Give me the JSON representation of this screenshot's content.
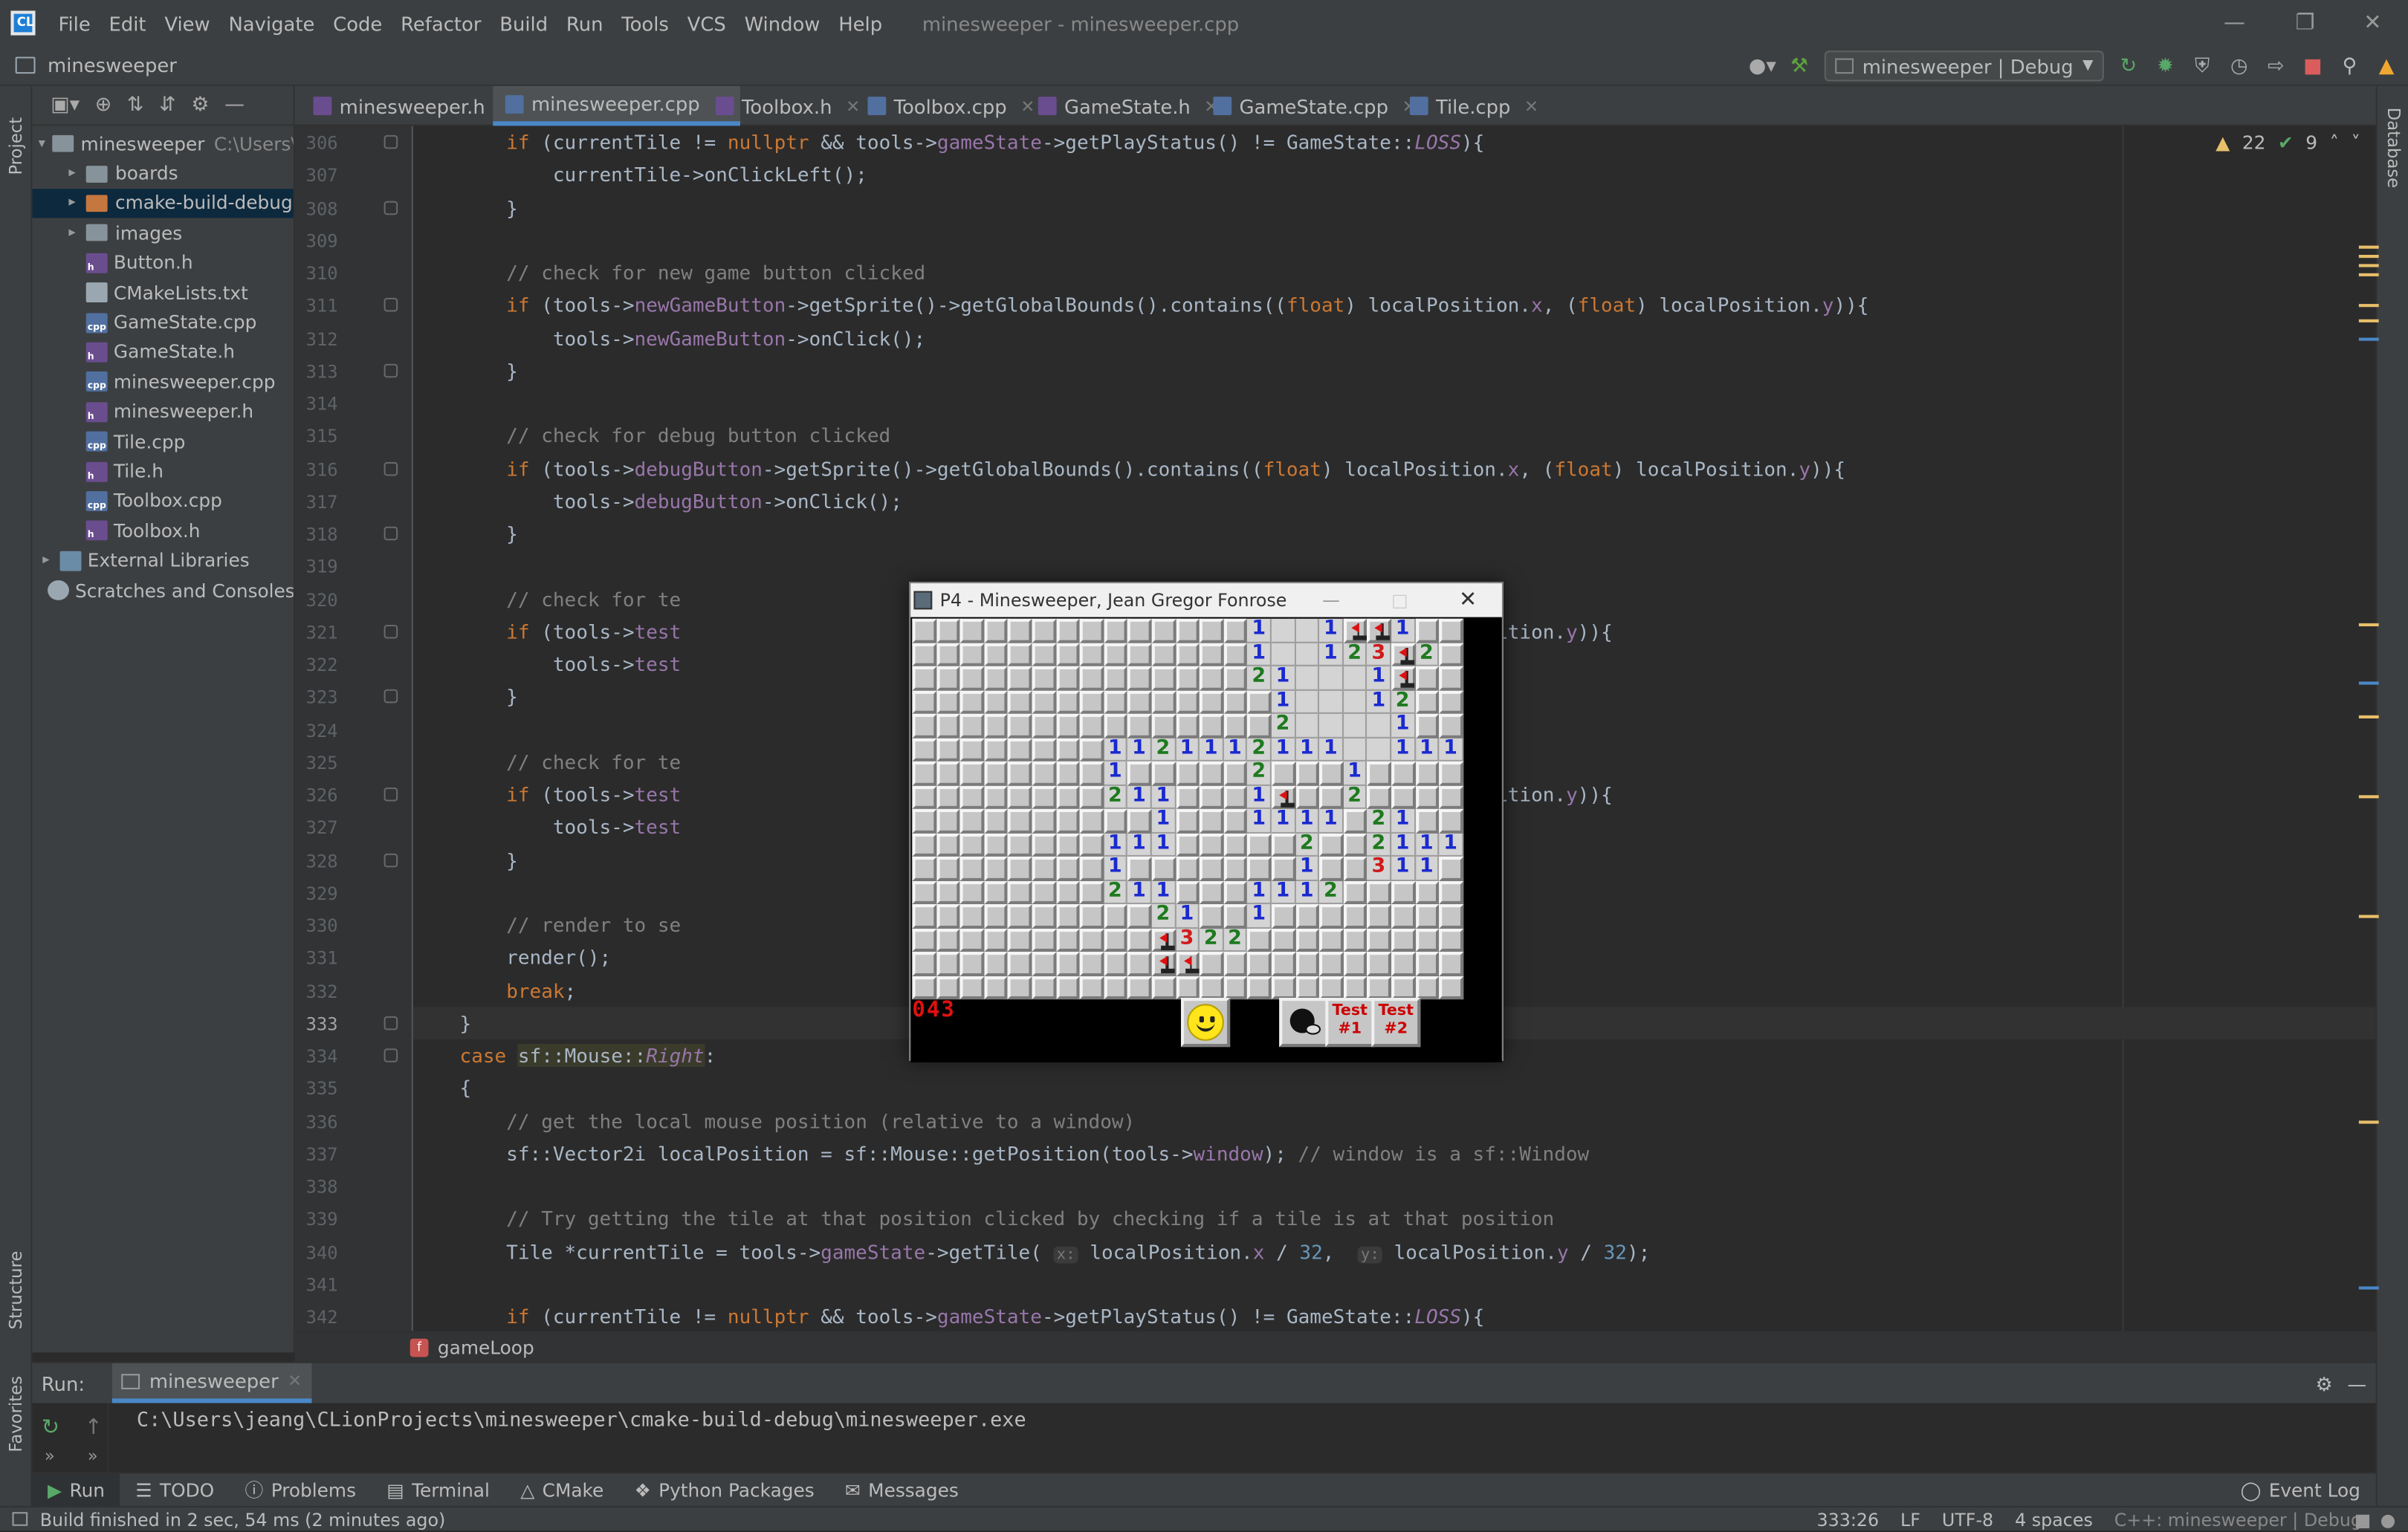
{
  "app": {
    "window_title": "minesweeper - minesweeper.cpp",
    "menu": [
      "File",
      "Edit",
      "View",
      "Navigate",
      "Code",
      "Refactor",
      "Build",
      "Run",
      "Tools",
      "VCS",
      "Window",
      "Help"
    ],
    "project_name": "minesweeper",
    "run_config": "minesweeper | Debug"
  },
  "sidebar": {
    "vertical_labels": {
      "project": "Project",
      "structure": "Structure",
      "favorites": "Favorites",
      "database": "Database"
    },
    "tree": [
      {
        "label": "minesweeper",
        "extra": "C:\\Users\\je",
        "type": "folder-open"
      },
      {
        "label": "boards",
        "type": "folder"
      },
      {
        "label": "cmake-build-debug",
        "type": "folder-orange"
      },
      {
        "label": "images",
        "type": "folder"
      },
      {
        "label": "Button.h",
        "type": "h"
      },
      {
        "label": "CMakeLists.txt",
        "type": "txt"
      },
      {
        "label": "GameState.cpp",
        "type": "cpp"
      },
      {
        "label": "GameState.h",
        "type": "h"
      },
      {
        "label": "minesweeper.cpp",
        "type": "cpp"
      },
      {
        "label": "minesweeper.h",
        "type": "h"
      },
      {
        "label": "Tile.cpp",
        "type": "cpp"
      },
      {
        "label": "Tile.h",
        "type": "h"
      },
      {
        "label": "Toolbox.cpp",
        "type": "cpp"
      },
      {
        "label": "Toolbox.h",
        "type": "h"
      },
      {
        "label": "External Libraries",
        "type": "lib"
      },
      {
        "label": "Scratches and Consoles",
        "type": "scratch"
      }
    ]
  },
  "tabs": [
    {
      "label": "minesweeper.h",
      "type": "h"
    },
    {
      "label": "minesweeper.cpp",
      "type": "cpp",
      "active": true
    },
    {
      "label": "Toolbox.h",
      "type": "h"
    },
    {
      "label": "Toolbox.cpp",
      "type": "cpp"
    },
    {
      "label": "GameState.h",
      "type": "h"
    },
    {
      "label": "GameState.cpp",
      "type": "cpp"
    },
    {
      "label": "Tile.cpp",
      "type": "cpp"
    }
  ],
  "editor": {
    "inspections": {
      "warnings": "22",
      "ok": "9"
    },
    "lines": [
      306,
      307,
      308,
      309,
      310,
      311,
      312,
      313,
      314,
      315,
      316,
      317,
      318,
      319,
      320,
      321,
      322,
      323,
      324,
      325,
      326,
      327,
      328,
      329,
      330,
      331,
      332,
      333,
      334,
      335,
      336,
      337,
      338,
      339,
      340,
      341,
      342
    ],
    "current_line": 333,
    "breadcrumb": "gameLoop"
  },
  "minesweeper": {
    "title": "P4 - Minesweeper, Jean Gregor Fonrose",
    "mine_counter": "043",
    "test1_label": "Test\n#1",
    "test2_label": "Test\n#2"
  },
  "run": {
    "label": "Run:",
    "tab": "minesweeper",
    "output": "C:\\Users\\jeang\\CLionProjects\\minesweeper\\cmake-build-debug\\minesweeper.exe"
  },
  "bottom_tabs": [
    "Run",
    "TODO",
    "Problems",
    "Terminal",
    "CMake",
    "Python Packages",
    "Messages"
  ],
  "event_log": "Event Log",
  "status": {
    "message": "Build finished in 2 sec, 54 ms (2 minutes ago)",
    "position": "333:26",
    "line_sep": "LF",
    "encoding": "UTF-8",
    "indent": "4 spaces",
    "context": "C++: minesweeper | Debug"
  },
  "colors": {
    "accent": "#4a88c7",
    "ide_bg": "#2b2b2b",
    "panel_bg": "#3c3f41",
    "mine_counter": "#e01010"
  }
}
